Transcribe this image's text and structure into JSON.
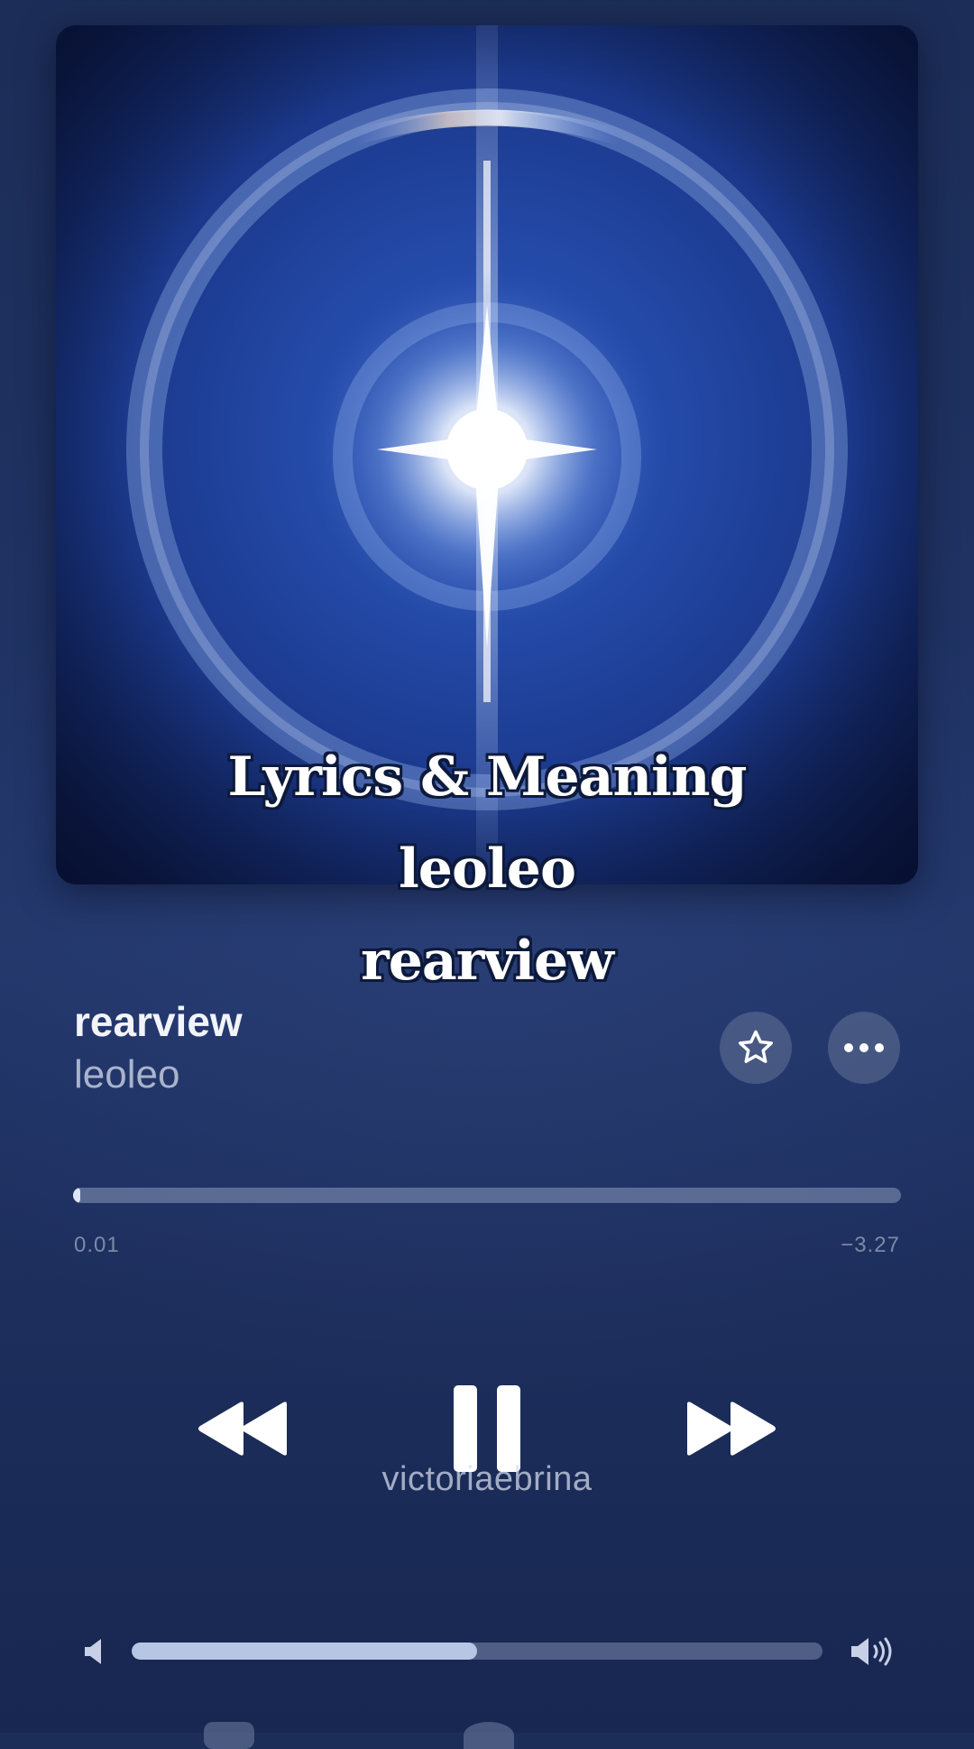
{
  "overlay": {
    "line1": "Lyrics & Meaning",
    "line2": "leoleo",
    "line3": "rearview"
  },
  "track": {
    "title": "rearview",
    "artist": "leoleo"
  },
  "actions": {
    "favorite_icon": "star-icon",
    "more_icon": "ellipsis-icon"
  },
  "progress": {
    "elapsed": "0.01",
    "remaining": "−3.27",
    "fraction": 0.005
  },
  "transport": {
    "rewind_icon": "rewind-icon",
    "pause_icon": "pause-icon",
    "forward_icon": "fast-forward-icon"
  },
  "watermark": "victoriaebrina",
  "volume": {
    "level": 0.5,
    "low_icon": "speaker-low-icon",
    "high_icon": "speaker-high-icon"
  },
  "colors": {
    "background": "#1f3262",
    "text_primary": "#f2f4fa",
    "text_secondary": "#a9b3cc"
  }
}
